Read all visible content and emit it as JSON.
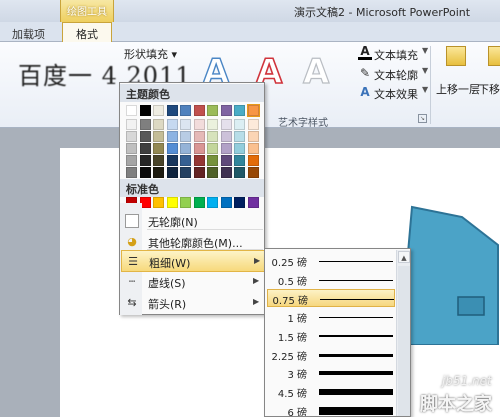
{
  "window": {
    "contextual_group": "绘图工具",
    "title": "演示文稿2 - Microsoft PowerPoint"
  },
  "tabs": [
    {
      "label": "加载项"
    },
    {
      "label": "格式"
    }
  ],
  "ribbon": {
    "blurred_overlay_text": "百度一    4 2011",
    "shape_fill": "形状填充 ▾",
    "wordart_styles": [
      {
        "glyph": "A",
        "color": "#4a86c5"
      },
      {
        "glyph": "A",
        "color": "#d0343c"
      },
      {
        "glyph": "A",
        "color": "#b9bdc3"
      }
    ],
    "text_tools": [
      {
        "icon": "text-fill-icon",
        "label": "文本填充"
      },
      {
        "icon": "text-outline-icon",
        "label": "文本轮廓"
      },
      {
        "icon": "text-effect-icon",
        "label": "文本效果"
      }
    ],
    "wordart_group_label": "艺术字样式",
    "bring_forward": "上移一层",
    "send_backward": "下移"
  },
  "outline_menu": {
    "theme_colors_title": "主题颜色",
    "standard_colors_title": "标准色",
    "theme_top_row": [
      "#ffffff",
      "#000000",
      "#eeece1",
      "#1f497d",
      "#4f81bd",
      "#c0504d",
      "#9bbb59",
      "#8064a2",
      "#4bacc6",
      "#f79646"
    ],
    "theme_shades": [
      [
        "#f2f2f2",
        "#7f7f7f",
        "#ddd9c3",
        "#c6d9f0",
        "#dbe5f1",
        "#f2dcdb",
        "#ebf1dd",
        "#e5e0ec",
        "#dbeef3",
        "#fdeada"
      ],
      [
        "#d8d8d8",
        "#595959",
        "#c4bd97",
        "#8db3e2",
        "#b8cce4",
        "#e5b9b7",
        "#d7e3bc",
        "#ccc1d9",
        "#b7dde8",
        "#fbd5b5"
      ],
      [
        "#bfbfbf",
        "#3f3f3f",
        "#938953",
        "#548dd4",
        "#95b3d7",
        "#d99694",
        "#c3d69b",
        "#b2a2c7",
        "#92cddc",
        "#fac08f"
      ],
      [
        "#a5a5a5",
        "#262626",
        "#494429",
        "#17365d",
        "#366092",
        "#953734",
        "#76923c",
        "#5f497a",
        "#31859b",
        "#e36c09"
      ],
      [
        "#7f7f7f",
        "#0c0c0c",
        "#1d1b10",
        "#0f243e",
        "#244061",
        "#632423",
        "#4f6128",
        "#3f3151",
        "#205867",
        "#974806"
      ]
    ],
    "standard_colors": [
      "#c00000",
      "#ff0000",
      "#ffc000",
      "#ffff00",
      "#92d050",
      "#00b050",
      "#00b0f0",
      "#0070c0",
      "#002060",
      "#7030a0"
    ],
    "no_outline": "无轮廓(N)",
    "more_colors": "其他轮廓颜色(M)...",
    "weight": "粗细(W)",
    "dashes": "虚线(S)",
    "arrows": "箭头(R)"
  },
  "weight_menu": {
    "selected_index": 2,
    "items": [
      {
        "label": "0.25 磅",
        "pt": 0.25
      },
      {
        "label": "0.5 磅",
        "pt": 0.5
      },
      {
        "label": "0.75 磅",
        "pt": 0.75
      },
      {
        "label": "1 磅",
        "pt": 1
      },
      {
        "label": "1.5 磅",
        "pt": 1.5
      },
      {
        "label": "2.25 磅",
        "pt": 2.25
      },
      {
        "label": "3 磅",
        "pt": 3
      },
      {
        "label": "4.5 磅",
        "pt": 4.5
      },
      {
        "label": "6 磅",
        "pt": 6
      }
    ]
  },
  "watermark": {
    "domain": "jb51.net",
    "site": "脚本之家"
  }
}
